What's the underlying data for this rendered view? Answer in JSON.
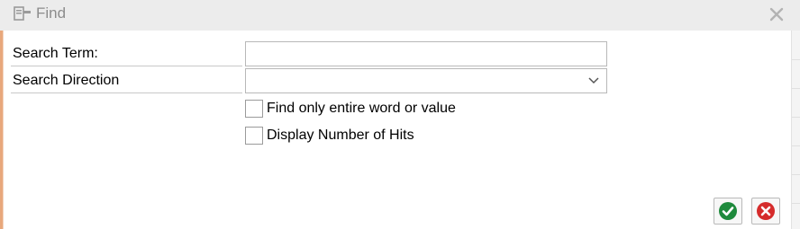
{
  "dialog": {
    "title": "Find",
    "title_icon": "find-dialog-icon",
    "close_icon": "close-icon"
  },
  "fields": {
    "search_term": {
      "label": "Search Term:",
      "value": ""
    },
    "search_direction": {
      "label": "Search Direction",
      "value": "",
      "icon": "chevron-down-icon"
    }
  },
  "options": {
    "entire_word": {
      "label": "Find only entire word or value",
      "checked": false
    },
    "display_hits": {
      "label": "Display Number of Hits",
      "checked": false
    }
  },
  "buttons": {
    "ok": {
      "icon": "checkmark-icon",
      "color": "#1e8a3c"
    },
    "cancel": {
      "icon": "cancel-icon",
      "color": "#d52b2b"
    }
  }
}
